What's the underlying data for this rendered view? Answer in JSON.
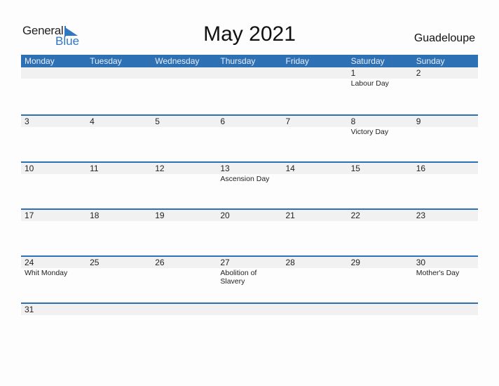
{
  "logo": {
    "line1": "General",
    "line2": "Blue"
  },
  "title": "May 2021",
  "country": "Guadeloupe",
  "colors": {
    "accent": "#2e70b4",
    "band": "#f1f1f1"
  },
  "weekdays": [
    "Monday",
    "Tuesday",
    "Wednesday",
    "Thursday",
    "Friday",
    "Saturday",
    "Sunday"
  ],
  "weeks": [
    [
      {
        "d": "",
        "h": ""
      },
      {
        "d": "",
        "h": ""
      },
      {
        "d": "",
        "h": ""
      },
      {
        "d": "",
        "h": ""
      },
      {
        "d": "",
        "h": ""
      },
      {
        "d": "1",
        "h": "Labour Day"
      },
      {
        "d": "2",
        "h": ""
      }
    ],
    [
      {
        "d": "3",
        "h": ""
      },
      {
        "d": "4",
        "h": ""
      },
      {
        "d": "5",
        "h": ""
      },
      {
        "d": "6",
        "h": ""
      },
      {
        "d": "7",
        "h": ""
      },
      {
        "d": "8",
        "h": "Victory Day"
      },
      {
        "d": "9",
        "h": ""
      }
    ],
    [
      {
        "d": "10",
        "h": ""
      },
      {
        "d": "11",
        "h": ""
      },
      {
        "d": "12",
        "h": ""
      },
      {
        "d": "13",
        "h": "Ascension Day"
      },
      {
        "d": "14",
        "h": ""
      },
      {
        "d": "15",
        "h": ""
      },
      {
        "d": "16",
        "h": ""
      }
    ],
    [
      {
        "d": "17",
        "h": ""
      },
      {
        "d": "18",
        "h": ""
      },
      {
        "d": "19",
        "h": ""
      },
      {
        "d": "20",
        "h": ""
      },
      {
        "d": "21",
        "h": ""
      },
      {
        "d": "22",
        "h": ""
      },
      {
        "d": "23",
        "h": ""
      }
    ],
    [
      {
        "d": "24",
        "h": "Whit Monday"
      },
      {
        "d": "25",
        "h": ""
      },
      {
        "d": "26",
        "h": ""
      },
      {
        "d": "27",
        "h": "Abolition of Slavery"
      },
      {
        "d": "28",
        "h": ""
      },
      {
        "d": "29",
        "h": ""
      },
      {
        "d": "30",
        "h": "Mother's Day"
      }
    ],
    [
      {
        "d": "31",
        "h": ""
      },
      {
        "d": "",
        "h": ""
      },
      {
        "d": "",
        "h": ""
      },
      {
        "d": "",
        "h": ""
      },
      {
        "d": "",
        "h": ""
      },
      {
        "d": "",
        "h": ""
      },
      {
        "d": "",
        "h": ""
      }
    ]
  ]
}
